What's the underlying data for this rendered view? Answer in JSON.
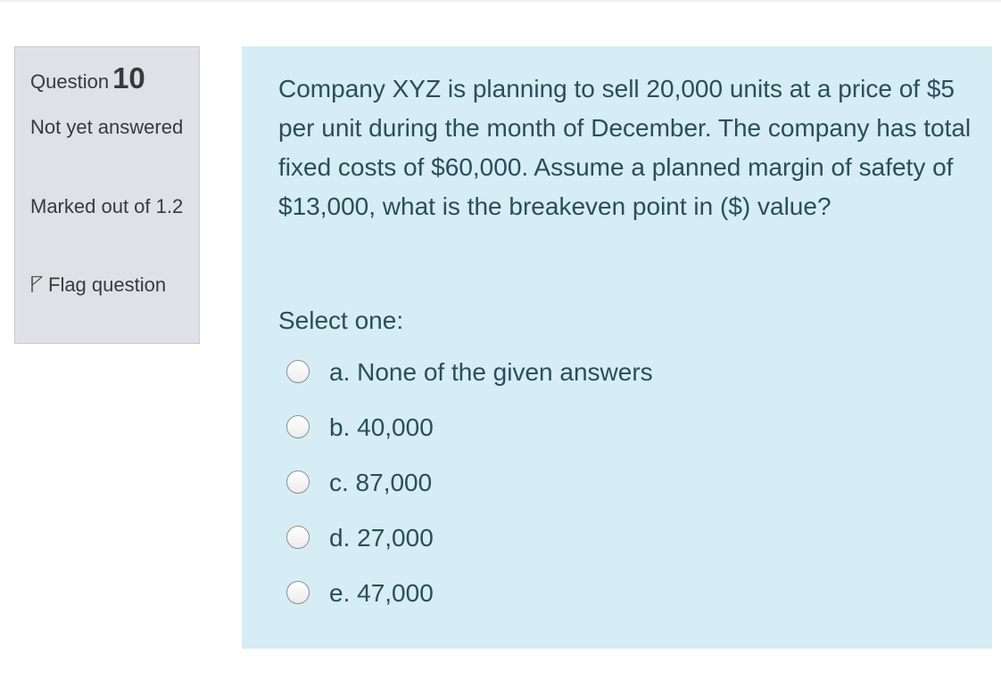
{
  "question_info": {
    "question_label": "Question",
    "question_number": "10",
    "state": "Not yet answered",
    "grade": "Marked out of 1.2",
    "flag_label": "Flag question"
  },
  "question": {
    "text": "Company XYZ is planning to sell 20,000 units at a price of $5 per unit during the month of December. The company has total fixed costs of $60,000. Assume a planned margin of safety of $13,000, what is the breakeven point in ($) value?",
    "prompt": "Select one:",
    "options": [
      {
        "label": "a. None of the given answers",
        "selected": false
      },
      {
        "label": "b. 40,000",
        "selected": false
      },
      {
        "label": "c. 87,000",
        "selected": false
      },
      {
        "label": "d. 27,000",
        "selected": false
      },
      {
        "label": "e. 47,000",
        "selected": false
      }
    ]
  },
  "colors": {
    "info_background": "#dee2e6",
    "content_background": "#d6edf5",
    "content_text": "#2b4e59"
  }
}
